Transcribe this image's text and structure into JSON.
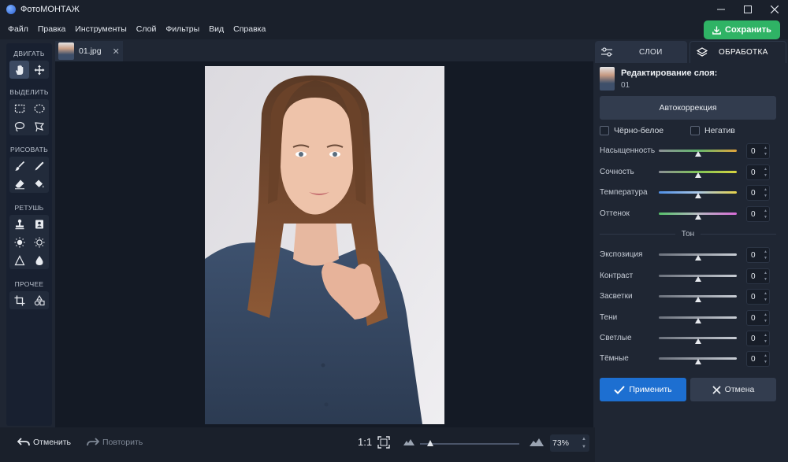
{
  "window": {
    "title": "ФотоМОНТАЖ",
    "controls": [
      "minimize-icon",
      "maximize-icon",
      "close-icon"
    ]
  },
  "menu": [
    "Файл",
    "Правка",
    "Инструменты",
    "Слой",
    "Фильтры",
    "Вид",
    "Справка"
  ],
  "save_button": "Сохранить",
  "toolbar": {
    "sections": [
      {
        "title": "ДВИГАТЬ",
        "tools": [
          "hand-icon",
          "move-icon"
        ]
      },
      {
        "title": "ВЫДЕЛИТЬ",
        "tools": [
          "rect-select-icon",
          "ellipse-select-icon",
          "lasso-icon",
          "polygon-lasso-icon"
        ]
      },
      {
        "title": "РИСОВАТЬ",
        "tools": [
          "brush-icon",
          "pencil-icon",
          "eraser-icon",
          "fill-bucket-icon"
        ]
      },
      {
        "title": "РЕТУШЬ",
        "tools": [
          "stamp-icon",
          "patch-icon",
          "brightness-icon",
          "dodge-icon",
          "sharpen-icon",
          "blur-drop-icon"
        ]
      },
      {
        "title": "ПРОЧЕЕ",
        "tools": [
          "crop-icon",
          "shapes-icon"
        ]
      }
    ]
  },
  "document_tab": {
    "name": "01.jpg"
  },
  "bottom": {
    "undo": "Отменить",
    "redo": "Повторить",
    "ratio": "1:1",
    "zoom_fraction": 0.1,
    "zoom_value": "73%"
  },
  "panel": {
    "tabs": [
      "СЛОИ",
      "ОБРАБОТКА"
    ],
    "layer_title": "Редактирование слоя:",
    "layer_name": "01",
    "auto_button": "Автокоррекция",
    "checkbox_bw": "Чёрно-белое",
    "checkbox_negative": "Негатив",
    "color_sliders": [
      {
        "label": "Насыщенность",
        "value": "0"
      },
      {
        "label": "Сочность",
        "value": "0"
      },
      {
        "label": "Температура",
        "value": "0"
      },
      {
        "label": "Оттенок",
        "value": "0"
      }
    ],
    "tone_title": "Тон",
    "tone_sliders": [
      {
        "label": "Экспозиция",
        "value": "0"
      },
      {
        "label": "Контраст",
        "value": "0"
      },
      {
        "label": "Засветки",
        "value": "0"
      },
      {
        "label": "Тени",
        "value": "0"
      },
      {
        "label": "Светлые",
        "value": "0"
      },
      {
        "label": "Тёмные",
        "value": "0"
      }
    ],
    "apply_button": "Применить",
    "cancel_button": "Отмена"
  },
  "colors": {
    "save": "#2fb365",
    "apply": "#1d6fd1"
  }
}
